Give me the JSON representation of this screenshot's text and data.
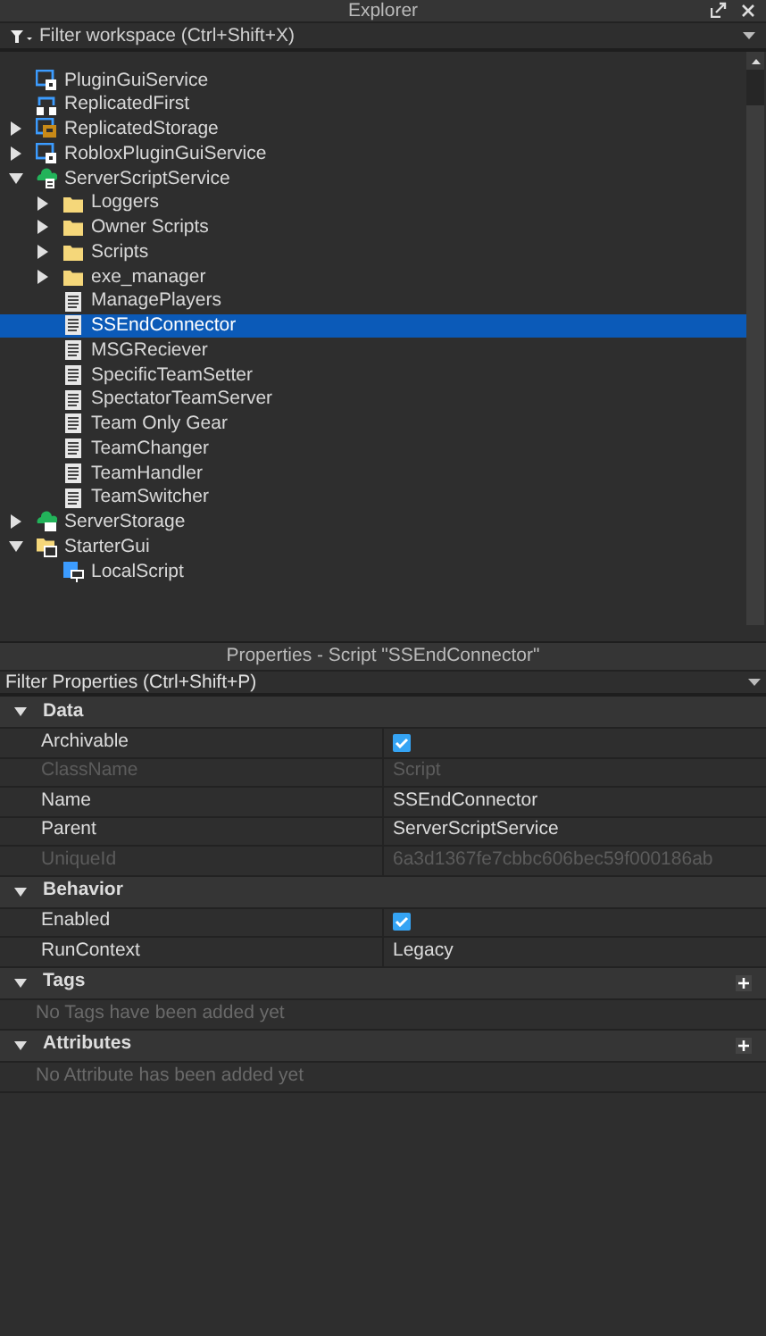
{
  "explorer": {
    "title": "Explorer",
    "filter": {
      "placeholder": "Filter workspace (Ctrl+Shift+X)"
    },
    "tree": [
      {
        "label": "PluginGuiService",
        "kind": "gui-service",
        "selected": false
      },
      {
        "label": "ReplicatedFirst",
        "kind": "replicated-first",
        "selected": false
      },
      {
        "label": "ReplicatedStorage",
        "kind": "storage",
        "expanded": false,
        "selected": false
      },
      {
        "label": "RobloxPluginGuiService",
        "kind": "gui-service",
        "expanded": false,
        "selected": false
      },
      {
        "label": "ServerScriptService",
        "kind": "server-service",
        "expanded": true,
        "selected": false,
        "children": [
          {
            "label": "Loggers",
            "kind": "folder",
            "expanded": false,
            "selected": false
          },
          {
            "label": "Owner Scripts",
            "kind": "folder",
            "expanded": false,
            "selected": false
          },
          {
            "label": "Scripts",
            "kind": "folder",
            "expanded": false,
            "selected": false
          },
          {
            "label": "exe_manager",
            "kind": "folder",
            "expanded": false,
            "selected": false
          },
          {
            "label": "ManagePlayers",
            "kind": "script",
            "selected": false
          },
          {
            "label": "SSEndConnector",
            "kind": "script",
            "selected": true
          },
          {
            "label": "MSGReciever",
            "kind": "script",
            "selected": false
          },
          {
            "label": "SpecificTeamSetter",
            "kind": "script",
            "selected": false
          },
          {
            "label": "SpectatorTeamServer",
            "kind": "script",
            "selected": false
          },
          {
            "label": "Team Only Gear",
            "kind": "script",
            "selected": false
          },
          {
            "label": "TeamChanger",
            "kind": "script",
            "selected": false
          },
          {
            "label": "TeamHandler",
            "kind": "script",
            "selected": false
          },
          {
            "label": "TeamSwitcher",
            "kind": "script",
            "selected": false
          }
        ]
      },
      {
        "label": "ServerStorage",
        "kind": "server-storage",
        "expanded": false,
        "selected": false
      },
      {
        "label": "StarterGui",
        "kind": "gui-folder",
        "expanded": true,
        "selected": false,
        "children": [
          {
            "label": "LocalScript",
            "kind": "local-script",
            "selected": false
          }
        ]
      }
    ]
  },
  "properties": {
    "title": "Properties - Script \"SSEndConnector\"",
    "filter": {
      "placeholder": "Filter Properties (Ctrl+Shift+P)"
    },
    "sections": [
      {
        "title": "Data",
        "expanded": true,
        "add_button": false,
        "rows": [
          {
            "kind": "checkbox",
            "name": "Archivable",
            "checked": true,
            "disabled": false
          },
          {
            "kind": "text",
            "name": "ClassName",
            "value": "Script",
            "disabled": true
          },
          {
            "kind": "text",
            "name": "Name",
            "value": "SSEndConnector",
            "disabled": false
          },
          {
            "kind": "text",
            "name": "Parent",
            "value": "ServerScriptService",
            "disabled": false
          },
          {
            "kind": "text",
            "name": "UniqueId",
            "value": "6a3d1367fe7cbbc606bec59f000186ab",
            "disabled": true
          }
        ]
      },
      {
        "title": "Behavior",
        "expanded": true,
        "add_button": false,
        "rows": [
          {
            "kind": "checkbox",
            "name": "Enabled",
            "checked": true,
            "disabled": false
          },
          {
            "kind": "text",
            "name": "RunContext",
            "value": "Legacy",
            "disabled": false
          }
        ]
      },
      {
        "title": "Tags",
        "expanded": true,
        "add_button": true,
        "empty": "No Tags have been added yet"
      },
      {
        "title": "Attributes",
        "expanded": true,
        "add_button": true,
        "empty": "No Attribute has been added yet"
      }
    ]
  }
}
